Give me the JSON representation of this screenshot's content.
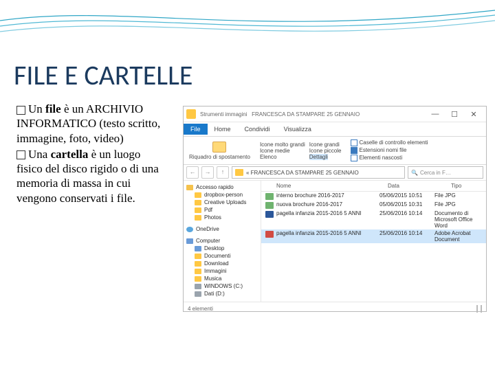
{
  "slide": {
    "title": "FILE E CARTELLE",
    "bullet1_lead": "Un ",
    "bullet1_bold": "file",
    "bullet1_rest": " è un ARCHIVIO INFORMATICO (testo scritto, immagine, foto, video)",
    "bullet2_lead": "Una ",
    "bullet2_bold": "cartella",
    "bullet2_rest": " è un luogo fisico del disco rigido o di una memoria di massa in cui vengono conservati i file."
  },
  "explorer": {
    "titlebar": {
      "tools": "Strumenti immagini",
      "path": "FRANCESCA DA STAMPARE 25 GENNAIO"
    },
    "winbtns": {
      "min": "—",
      "max": "☐",
      "close": "✕"
    },
    "ribbon": {
      "file": "File",
      "home": "Home",
      "share": "Condividi",
      "view": "Visualizza"
    },
    "ribrow": {
      "navpane": "Riquadro di spostamento",
      "xl": "Icone molto grandi",
      "lg": "Icone grandi",
      "md": "Icone medie",
      "sm": "Icone piccole",
      "list": "Elenco",
      "details": "Dettagli",
      "chk1": "Caselle di controllo elementi",
      "chk2": "Estensioni nomi file",
      "chk3": "Elementi nascosti"
    },
    "nav": {
      "back": "←",
      "fwd": "→",
      "up": "↑"
    },
    "address": "« FRANCESCA DA STAMPARE 25 GENNAIO",
    "search": "Cerca in F…",
    "sidebar": {
      "fav": "Accesso rapido",
      "db": "dropbox-person",
      "cu": "Creative Uploads",
      "pdf": "Pdf",
      "photo": "Photos",
      "od": "OneDrive",
      "pc": "Computer",
      "dk": "Desktop",
      "doc": "Documenti",
      "dl": "Download",
      "img": "Immagini",
      "mus": "Musica",
      "win": "WINDOWS (C:)",
      "dat": "Dati (D:)"
    },
    "cols": {
      "name": "Nome",
      "date": "Data",
      "type": "Tipo"
    },
    "files": [
      {
        "name": "interno brochure 2016-2017",
        "date": "05/06/2015 10:51",
        "type": "File JPG"
      },
      {
        "name": "nuova brochure 2016-2017",
        "date": "05/06/2015 10:31",
        "type": "File JPG"
      },
      {
        "name": "pagella infanzia 2015-2016 5 ANNI",
        "date": "25/06/2016 10:14",
        "type": "Documento di Microsoft Office Word"
      },
      {
        "name": "pagella infanzia 2015-2016 5 ANNI",
        "date": "25/06/2016 10:14",
        "type": "Adobe Acrobat Document"
      }
    ],
    "status": "4 elementi"
  }
}
